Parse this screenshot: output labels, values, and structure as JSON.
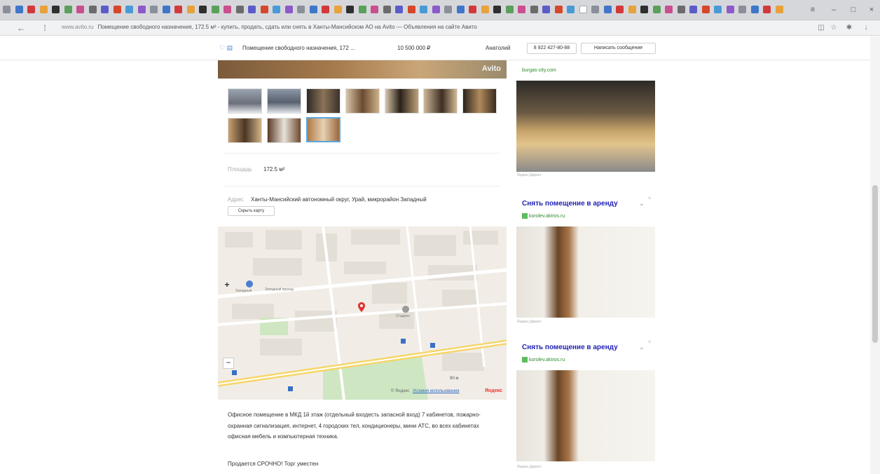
{
  "browser": {
    "tab_count": 64,
    "active_tab_index": 47,
    "url_domain": "www.avito.ru",
    "url_title": "Помещение свободного назначения, 172.5 м² - купить, продать, сдать или снять в Ханты-Мансийском АО на Avito — Объявления на сайте Авито"
  },
  "sticky_header": {
    "title": "Помещение свободного назначения, 172 ...",
    "price": "10 500 000 ₽",
    "seller_name": "Анатолий",
    "phone_label": "8 922 427-80-88",
    "message_label": "Написать сообщение"
  },
  "gallery": {
    "watermark": "Avito",
    "thumbnail_count": 10,
    "selected_thumbnail": 9
  },
  "details": {
    "area_label": "Площадь",
    "area_value": "172.5 м²",
    "address_label": "Адрес",
    "address_value": "Ханты-Мансийский автономный округ, Урай, микрорайон Западный",
    "hide_map_label": "Скрыть карту"
  },
  "map": {
    "zoom_in": "+",
    "zoom_out": "−",
    "scale_text": "90 м",
    "attribution": "© Яндекс",
    "terms": "Условия использования",
    "logo": "Яндекс",
    "labels": {
      "district": "Западный",
      "street_1": "Западный проезд",
      "poi": "Стадион"
    }
  },
  "description": {
    "text": "Офисное помещение в МКД 1й этаж (отдельный входесть запасной вход) 7 кабинетов, пожарно-охранная сигнализация, интернет, 4 городских тел, кондиционеры, мини АТС, во всех кабинетах офисная мебель и компьютерная техника.",
    "urgent": "Продается СРОЧНО! Торг уместен"
  },
  "ads": [
    {
      "title": "",
      "domain": "burgas-city.com",
      "mark": "Яндекс.Директ"
    },
    {
      "title": "Снять помещение в аренду",
      "domain": "korolev.aktros.ru",
      "mark": "Яндекс.Директ"
    },
    {
      "title": "Снять помещение в аренду",
      "domain": "korolev.aktros.ru",
      "mark": "Яндекс.Директ"
    }
  ],
  "colors": {
    "ad_title": "#1f1fb5",
    "ad_domain": "#2e8b2e",
    "map_pin": "#e0332e",
    "selected_thumb_border": "#5aa7e0"
  }
}
